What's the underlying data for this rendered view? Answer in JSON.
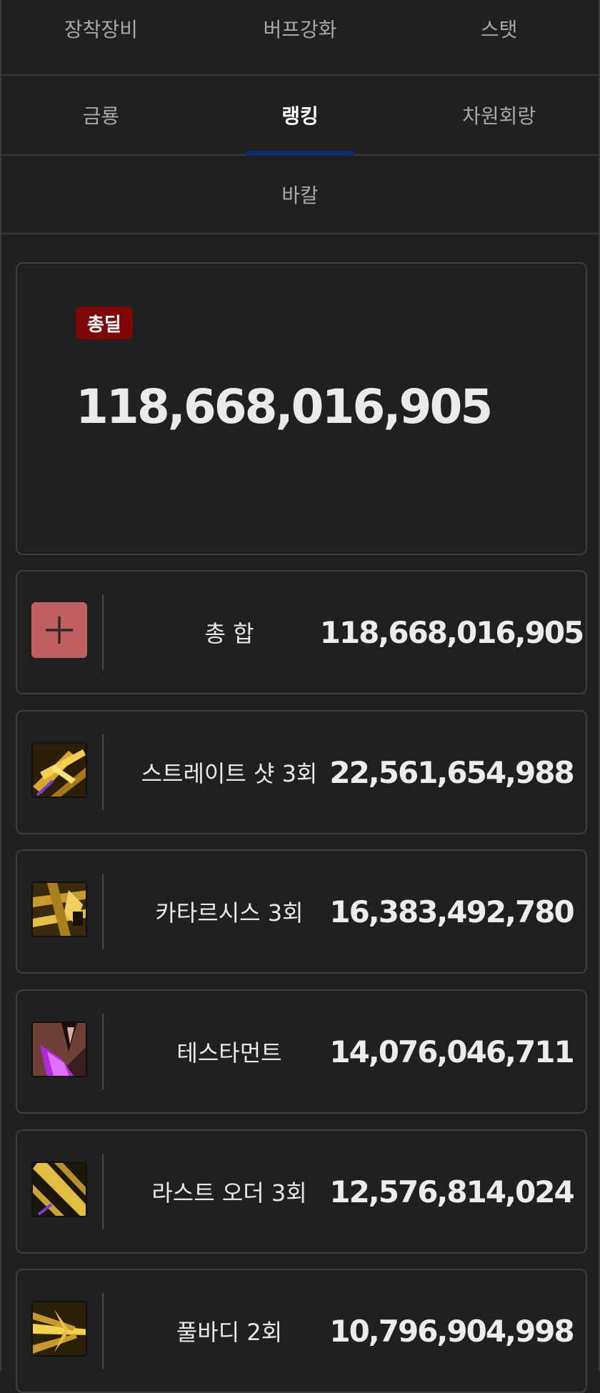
{
  "tabs_row1": [
    "장착장비",
    "버프강화",
    "스탯"
  ],
  "tabs_row2": [
    "금룡",
    "랭킹",
    "차원회랑"
  ],
  "tabs_row3": [
    "바칼"
  ],
  "active_tab": "랭킹",
  "colors": {
    "badge": "#7f0707",
    "active_underline": "#102a6e",
    "plus_button": "#c06060"
  },
  "summary": {
    "badge": "총딜",
    "total": "118,668,016,905"
  },
  "rows": [
    {
      "icon": "plus-icon",
      "name": "총 합",
      "value": "118,668,016,905"
    },
    {
      "icon": "straight-shot-skill-icon",
      "name": "스트레이트 샷 3회",
      "value": "22,561,654,988"
    },
    {
      "icon": "catharsis-skill-icon",
      "name": "카타르시스 3회",
      "value": "16,383,492,780"
    },
    {
      "icon": "testament-skill-icon",
      "name": "테스타먼트",
      "value": "14,076,046,711"
    },
    {
      "icon": "last-order-skill-icon",
      "name": "라스트 오더 3회",
      "value": "12,576,814,024"
    },
    {
      "icon": "full-body-skill-icon",
      "name": "풀바디 2회",
      "value": "10,796,904,998"
    }
  ]
}
